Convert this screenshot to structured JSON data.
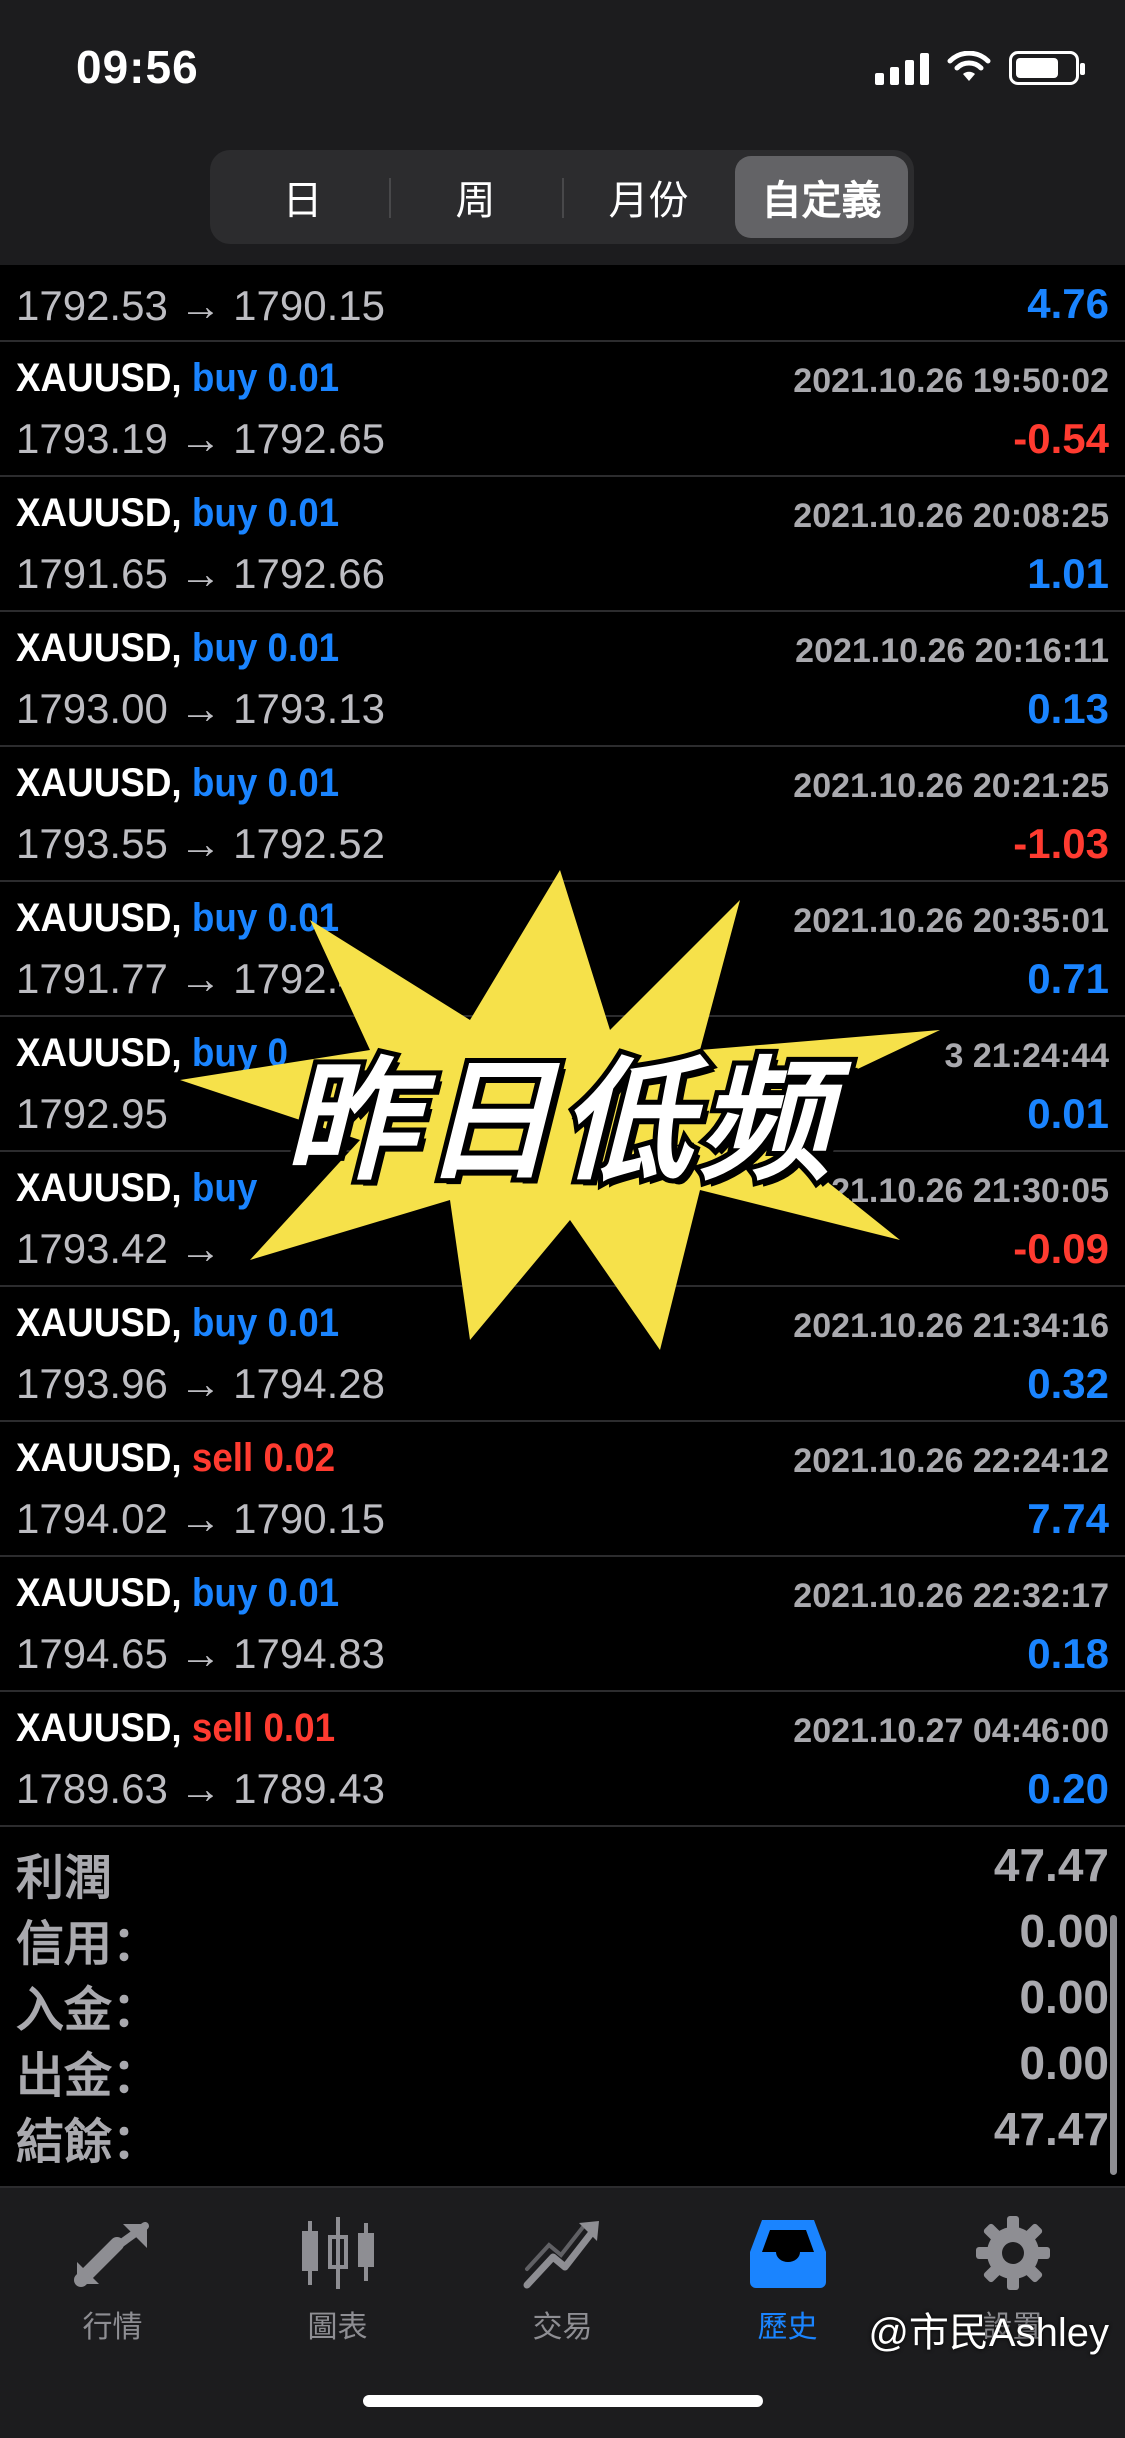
{
  "status_bar": {
    "time": "09:56"
  },
  "period_tabs": [
    {
      "label": "日",
      "active": false
    },
    {
      "label": "周",
      "active": false
    },
    {
      "label": "月份",
      "active": false
    },
    {
      "label": "自定義",
      "active": true
    }
  ],
  "partial_row": {
    "prices": "1792.53 → 1790.15",
    "profit": "4.76"
  },
  "trades": [
    {
      "symbol": "XAUUSD,",
      "side": "buy 0.01",
      "timestamp": "2021.10.26 19:50:02",
      "prices": "1793.19 → 1792.65",
      "profit": "-0.54"
    },
    {
      "symbol": "XAUUSD,",
      "side": "buy 0.01",
      "timestamp": "2021.10.26 20:08:25",
      "prices": "1791.65 → 1792.66",
      "profit": "1.01"
    },
    {
      "symbol": "XAUUSD,",
      "side": "buy 0.01",
      "timestamp": "2021.10.26 20:16:11",
      "prices": "1793.00 → 1793.13",
      "profit": "0.13"
    },
    {
      "symbol": "XAUUSD,",
      "side": "buy 0.01",
      "timestamp": "2021.10.26 20:21:25",
      "prices": "1793.55 → 1792.52",
      "profit": "-1.03"
    },
    {
      "symbol": "XAUUSD,",
      "side": "buy 0.01",
      "timestamp": "2021.10.26 20:35:01",
      "prices": "1791.77 → 1792.4",
      "profit": "0.71"
    },
    {
      "symbol": "XAUUSD,",
      "side": "buy 0",
      "timestamp": "3 21:24:44",
      "prices": "1792.95",
      "profit": "0.01"
    },
    {
      "symbol": "XAUUSD,",
      "side": "buy",
      "timestamp": "2021.10.26 21:30:05",
      "prices": "1793.42 →",
      "profit": "-0.09"
    },
    {
      "symbol": "XAUUSD,",
      "side": "buy 0.01",
      "timestamp": "2021.10.26 21:34:16",
      "prices": "1793.96 → 1794.28",
      "profit": "0.32"
    },
    {
      "symbol": "XAUUSD,",
      "side": "sell 0.02",
      "timestamp": "2021.10.26 22:24:12",
      "prices": "1794.02 → 1790.15",
      "profit": "7.74"
    },
    {
      "symbol": "XAUUSD,",
      "side": "buy 0.01",
      "timestamp": "2021.10.26 22:32:17",
      "prices": "1794.65 → 1794.83",
      "profit": "0.18"
    },
    {
      "symbol": "XAUUSD,",
      "side": "sell 0.01",
      "timestamp": "2021.10.27 04:46:00",
      "prices": "1789.63 → 1789.43",
      "profit": "0.20"
    }
  ],
  "summary": [
    {
      "label": "利潤",
      "value": "47.47"
    },
    {
      "label": "信用：",
      "value": "0.00"
    },
    {
      "label": "入金：",
      "value": "0.00"
    },
    {
      "label": "出金：",
      "value": "0.00"
    },
    {
      "label": "結餘：",
      "value": "47.47"
    }
  ],
  "sticker": {
    "text": "昨日低频",
    "fill_color": "#f6e14a"
  },
  "tabs": [
    {
      "label": "行情",
      "icon": "quotes-arrows-icon",
      "active": false
    },
    {
      "label": "圖表",
      "icon": "candlestick-chart-icon",
      "active": false
    },
    {
      "label": "交易",
      "icon": "trade-chart-icon",
      "active": false
    },
    {
      "label": "歷史",
      "icon": "history-inbox-icon",
      "active": true
    },
    {
      "label": "設置",
      "icon": "gear-icon",
      "active": false
    }
  ],
  "watermark": "@市民Ashley",
  "colors": {
    "accent": "#1a84ff",
    "loss": "#ff3b30",
    "background": "#000000"
  }
}
